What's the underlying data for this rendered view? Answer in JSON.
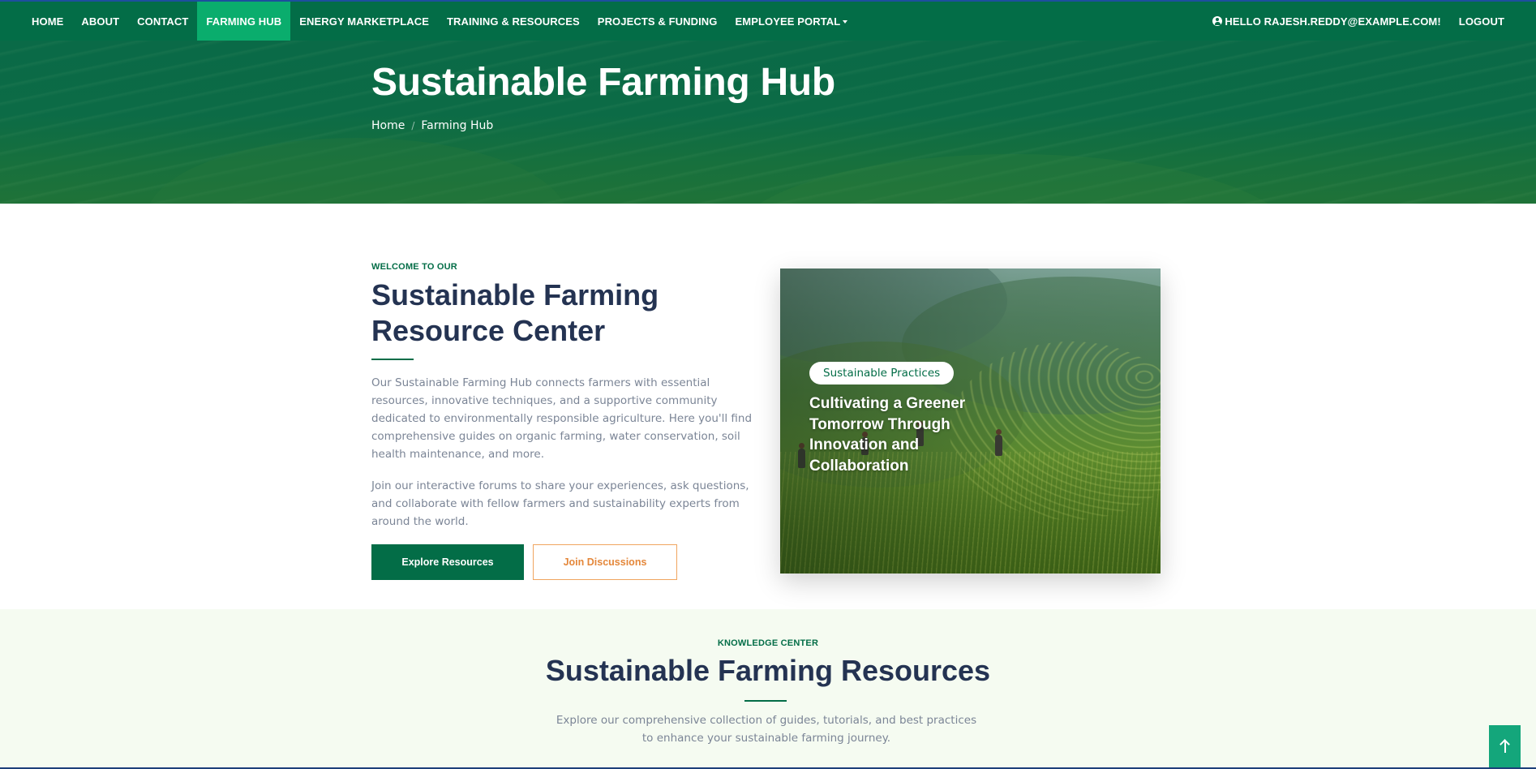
{
  "nav": {
    "items": [
      {
        "label": "HOME",
        "active": false
      },
      {
        "label": "ABOUT",
        "active": false
      },
      {
        "label": "CONTACT",
        "active": false
      },
      {
        "label": "FARMING HUB",
        "active": true
      },
      {
        "label": "ENERGY MARKETPLACE",
        "active": false
      },
      {
        "label": "TRAINING & RESOURCES",
        "active": false
      },
      {
        "label": "PROJECTS & FUNDING",
        "active": false
      },
      {
        "label": "EMPLOYEE PORTAL",
        "active": false,
        "dropdown": true
      }
    ],
    "user_greeting": "HELLO RAJESH.REDDY@EXAMPLE.COM!",
    "logout_label": "LOGOUT"
  },
  "hero": {
    "title": "Sustainable Farming Hub",
    "breadcrumb": {
      "home": "Home",
      "separator": "/",
      "current": "Farming Hub"
    }
  },
  "welcome": {
    "eyebrow": "WELCOME TO OUR",
    "title": "Sustainable Farming Resource Center",
    "paragraph1": "Our Sustainable Farming Hub connects farmers with essential resources, innovative techniques, and a supportive community dedicated to environmentally responsible agriculture. Here you'll find comprehensive guides on organic farming, water conservation, soil health maintenance, and more.",
    "paragraph2": "Join our interactive forums to share your experiences, ask questions, and collaborate with fellow farmers and sustainability experts from around the world.",
    "primary_button": "Explore Resources",
    "secondary_button": "Join Discussions"
  },
  "feature": {
    "tag": "Sustainable Practices",
    "caption": "Cultivating a Greener Tomorrow Through Innovation and Collaboration"
  },
  "knowledge": {
    "eyebrow": "KNOWLEDGE CENTER",
    "title": "Sustainable Farming Resources",
    "description": "Explore our comprehensive collection of guides, tutorials, and best practices to enhance your sustainable farming journey."
  },
  "colors": {
    "primary_green": "#036d47",
    "active_nav": "#0aad6d",
    "accent_orange": "#e4873a",
    "heading_navy": "#243352",
    "section_bg": "#f5fbf1"
  },
  "icons": {
    "user": "user-circle-icon",
    "scroll_top": "arrow-up-icon"
  }
}
